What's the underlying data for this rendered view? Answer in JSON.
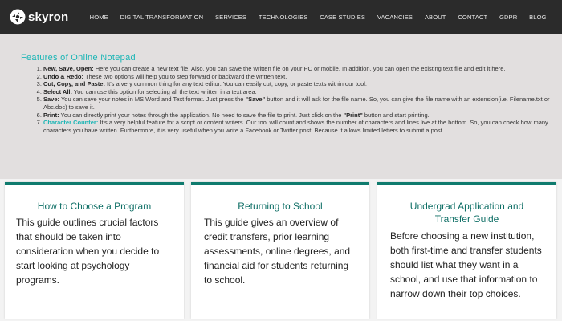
{
  "brand": {
    "name": "skyron"
  },
  "nav": [
    "HOME",
    "DIGITAL TRANSFORMATION",
    "SERVICES",
    "TECHNOLOGIES",
    "CASE STUDIES",
    "VACANCIES",
    "ABOUT",
    "CONTACT",
    "GDPR",
    "BLOG"
  ],
  "features": {
    "title": "Features of Online Notepad",
    "items": [
      {
        "term": "New, Save, Open:",
        "text": " Here you can create a new text file. Also, you can save the written file on your PC or mobile. In addition, you can open the existing text file and edit it here."
      },
      {
        "term": "Undo & Redo:",
        "text": " These two options will help you to step forward or backward the written text."
      },
      {
        "term": "Cut, Copy, and Paste:",
        "text": " It's a very common thing for any text editor. You can easily cut, copy, or paste texts within our tool."
      },
      {
        "term": "Select All:",
        "text": " You can use this option for selecting all the text written in a text area."
      },
      {
        "term": "Save:",
        "text_a": " You can save your notes in MS Word and Text format. Just press the ",
        "bold": "\"Save\"",
        "text_b": " button and it will ask for the file name. So, you can give the file name with an extension(i.e. Filename.txt or Abc.doc) to save it."
      },
      {
        "term": "Print:",
        "text_a": " You can directly print your notes through the application. No need to save the file to print. Just click on the ",
        "bold": "\"Print\"",
        "text_b": " button and start printing."
      },
      {
        "term": "Character Counter:",
        "text": " It's a very helpful feature for a script or content writers. Our tool will count and shows the number of characters and lines live at the bottom. So, you can check how many characters you have written. Furthermore, it is very useful when you write a Facebook or Twitter post. Because it allows limited letters to submit a post."
      }
    ]
  },
  "cards": [
    {
      "title": "How to Choose a Program",
      "body": "This guide outlines crucial factors that should be taken into consideration when you decide to start looking at psychology programs."
    },
    {
      "title": "Returning to School",
      "body": "This guide gives an overview of credit transfers, prior learning assessments, online degrees, and financial aid for students returning to school."
    },
    {
      "title": "Undergrad Application and Transfer Guide",
      "body": "Before choosing a new institution, both first-time and transfer students should list what they want in a school, and use that information to narrow down their top choices."
    }
  ],
  "colors": {
    "accent": "#19b5b5",
    "card_border": "#0f7b6e",
    "topbar": "#2b2b2b"
  },
  "icons": {
    "logo": "skyron-logo-icon"
  }
}
